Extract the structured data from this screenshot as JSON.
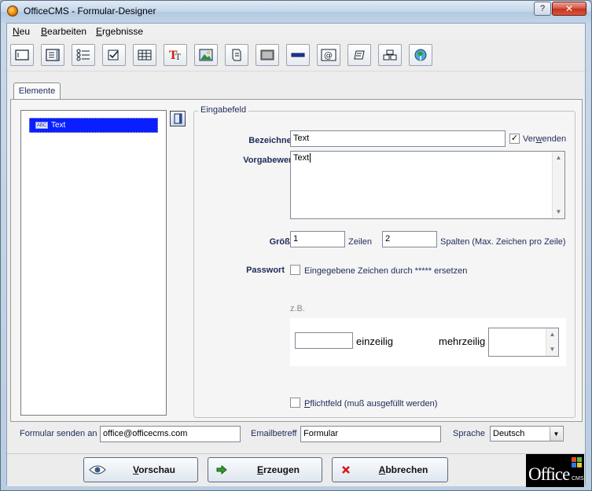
{
  "window": {
    "title": "OfficeCMS - Formular-Designer",
    "help_label": "?",
    "close_label": "✕"
  },
  "menu": [
    {
      "pre": "",
      "accel": "N",
      "post": "eu"
    },
    {
      "pre": "",
      "accel": "B",
      "post": "earbeiten"
    },
    {
      "pre": "",
      "accel": "E",
      "post": "rgebnisse"
    }
  ],
  "toolbar_icons": [
    "textfield-icon",
    "textarea-icon",
    "list-icon",
    "checkbox-icon",
    "table-icon",
    "text-format-icon",
    "image-icon",
    "scroll-icon",
    "panel-icon",
    "separator-icon",
    "email-icon",
    "page-icon",
    "layout-icon",
    "web-icon"
  ],
  "tab": {
    "label": "Elemente"
  },
  "element_list": {
    "items": [
      {
        "badge": "ABC",
        "label": "Text"
      }
    ]
  },
  "form": {
    "legend": "Eingabefeld",
    "bezeichner_label": "Bezeichner",
    "bezeichner_value": "Text",
    "verwenden_checked": "✓",
    "verwenden_pre": "Ver",
    "verwenden_accel": "w",
    "verwenden_post": "enden",
    "vorgabewert_label": "Vorgabewert",
    "vorgabewert_value": "Text",
    "groesse_label": "Größe",
    "zeilen_value": "1",
    "zeilen_label": "Zeilen",
    "spalten_value": "2",
    "spalten_label": "Spalten (Max. Zeichen pro Zeile)",
    "passwort_label": "Passwort",
    "passwort_text": "Eingegebene Zeichen durch ***** ersetzen",
    "example_label": "z.B.",
    "einzeilig_label": "einzeilig",
    "mehrzeilig_label": "mehrzeilig",
    "pflicht_accel": "P",
    "pflicht_post": "flichtfeld (muß ausgefüllt werden)"
  },
  "bottom": {
    "send_label": "Formular senden an",
    "send_value": "office@officecms.com",
    "subject_label": "Emailbetreff",
    "subject_value": "Formular",
    "language_label": "Sprache",
    "language_value": "Deutsch"
  },
  "buttons": {
    "preview": {
      "accel": "V",
      "post": "orschau"
    },
    "generate": {
      "accel": "E",
      "post": "rzeugen"
    },
    "cancel": {
      "accel": "A",
      "post": "bbrechen"
    }
  },
  "logo": {
    "word": "Office",
    "suffix": "CMS"
  },
  "colors": {
    "selection": "#0a1fff",
    "label": "#1e2a5a",
    "close": "#c4321c"
  }
}
